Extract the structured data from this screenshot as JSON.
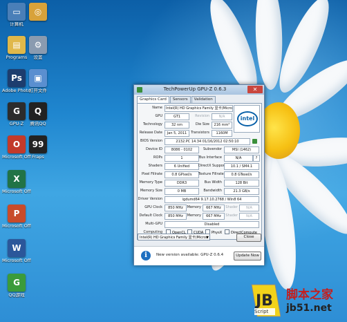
{
  "desktop": {
    "icons": [
      {
        "label": "计算机",
        "name": "computer-icon",
        "color": "#4a7fb8",
        "glyph": "▭"
      },
      {
        "label": "",
        "name": "game-icon",
        "color": "#d8a23a",
        "glyph": "◎"
      },
      {
        "label": "Programs",
        "name": "programs-folder-icon",
        "color": "#e0b84a",
        "glyph": "▤"
      },
      {
        "label": "设置",
        "name": "settings-icon",
        "color": "#8a9bb0",
        "glyph": "⚙"
      },
      {
        "label": "Adobe Photoshop",
        "name": "photoshop-icon",
        "color": "#1d3d6e",
        "glyph": "Ps"
      },
      {
        "label": "打开文件",
        "name": "file-icon",
        "color": "#5a8fd0",
        "glyph": "▣"
      },
      {
        "label": "GPU-Z",
        "name": "gpuz-icon",
        "color": "#2c2c2c",
        "glyph": "G"
      },
      {
        "label": "腾讯QQ",
        "name": "qq-icon",
        "color": "#222222",
        "glyph": "Q"
      },
      {
        "label": "Microsoft Office",
        "name": "office-icon",
        "color": "#c23a2a",
        "glyph": "O"
      },
      {
        "label": "Fraps",
        "name": "fraps-icon",
        "color": "#222222",
        "glyph": "99"
      },
      {
        "label": "Microsoft Office Exc",
        "name": "excel-icon",
        "color": "#217346",
        "glyph": "X"
      },
      {
        "label": "Microsoft Office Pow",
        "name": "powerpoint-icon",
        "color": "#c84b2a",
        "glyph": "P"
      },
      {
        "label": "Microsoft Office Wor",
        "name": "word-icon",
        "color": "#2b579a",
        "glyph": "W"
      },
      {
        "label": "QQ游戏",
        "name": "qqgame-icon",
        "color": "#3b9b3b",
        "glyph": "G"
      }
    ]
  },
  "window": {
    "title": "TechPowerUp GPU-Z 0.6.3",
    "close": "✕",
    "tabs": [
      "Graphics Card",
      "Sensors",
      "Validation"
    ],
    "rows": {
      "name": {
        "label": "Name",
        "value": "Intel(R) HD Graphics Family 显卡(Micro..."
      },
      "gpu": {
        "label": "GPU",
        "value": "GT1",
        "label2": "Revision",
        "value2": "N/A"
      },
      "tech": {
        "label": "Technology",
        "value": "32 nm",
        "label2": "Die Size",
        "value2": "216 mm²"
      },
      "release": {
        "label": "Release Date",
        "value": "Jan 5, 2011",
        "label2": "Transistors",
        "value2": "1160M"
      },
      "bios": {
        "label": "BIOS Version",
        "value": "2132.PC 14.34  01/16/2012  02:50:10"
      },
      "device": {
        "label": "Device ID",
        "value": "8086 - 0102",
        "label2": "Subvendor",
        "value2": "MSI (1462)"
      },
      "rops": {
        "label": "ROPs",
        "value": "1",
        "label2": "Bus Interface",
        "value2": "N/A"
      },
      "shaders": {
        "label": "Shaders",
        "value": "6 Unified",
        "label2": "DirectX Support",
        "value2": "10.1 / SM4.1"
      },
      "fill": {
        "label": "Pixel Fillrate",
        "value": "0.8 GPixel/s",
        "label2": "Texture Fillrate",
        "value2": "0.8 GTexel/s"
      },
      "memtype": {
        "label": "Memory Type",
        "value": "DDR3",
        "label2": "Bus Width",
        "value2": "128 Bit"
      },
      "memsize": {
        "label": "Memory Size",
        "value": "0 MB",
        "label2": "Bandwidth",
        "value2": "21.3 GB/s"
      },
      "driver": {
        "label": "Driver Version",
        "value": "igdumd64 9.17.10.2768 / Win8 64"
      },
      "gpuclock": {
        "label": "GPU Clock",
        "value": "850 MHz",
        "label2": "Memory",
        "value2": "667 MHz",
        "label3": "Shader",
        "value3": "N/A"
      },
      "defclock": {
        "label": "Default Clock",
        "value": "850 MHz",
        "label2": "Memory",
        "value2": "667 MHz",
        "label3": "Shader",
        "value3": "N/A"
      },
      "multigpu": {
        "label": "Multi-GPU",
        "value": "Disabled"
      },
      "computing": {
        "label": "Computing",
        "options": [
          "OpenCL",
          "CUDA",
          "PhysX",
          "DirectCompute"
        ]
      }
    },
    "logo_text": "intel",
    "device_select": "Intel(R) HD Graphics Family 显卡(Micros",
    "close_button": "Close",
    "notice": {
      "text": "New version available: GPU-Z 0.6.4",
      "button": "Update Now",
      "icon": "i"
    }
  },
  "watermark": {
    "text": "脚本之家",
    "url": "jb51.net",
    "badge": "Script"
  }
}
